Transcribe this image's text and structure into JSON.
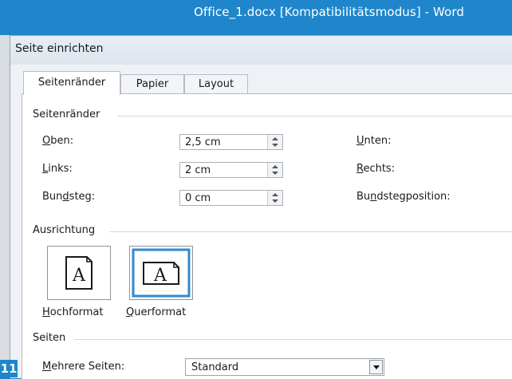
{
  "window": {
    "title": "Office_1.docx [Kompatibilitätsmodus] - Word"
  },
  "dialog": {
    "title": "Seite einrichten"
  },
  "tabs": [
    {
      "label": "Seitenränder",
      "active": true
    },
    {
      "label": "Papier",
      "active": false
    },
    {
      "label": "Layout",
      "active": false
    }
  ],
  "margins": {
    "group_label": "Seitenränder",
    "oben": {
      "label_pre": "",
      "label_u": "O",
      "label_post": "ben:",
      "value": "2,5 cm"
    },
    "links": {
      "label_pre": "",
      "label_u": "L",
      "label_post": "inks:",
      "value": "2 cm"
    },
    "bundsteg": {
      "label_pre": "Bun",
      "label_u": "d",
      "label_post": "steg:",
      "value": "0 cm"
    },
    "unten": {
      "label_pre": "",
      "label_u": "U",
      "label_post": "nten:"
    },
    "rechts": {
      "label_pre": "",
      "label_u": "R",
      "label_post": "echts:"
    },
    "bundstegposition": {
      "label_pre": "Bu",
      "label_u": "n",
      "label_post": "dstegposition:"
    }
  },
  "orientation": {
    "group_label": "Ausrichtung",
    "portrait": {
      "label_u": "H",
      "label_post": "ochformat",
      "glyph": "A",
      "selected": false
    },
    "landscape": {
      "label_u": "Q",
      "label_post": "uerformat",
      "glyph": "A",
      "selected": true
    }
  },
  "pages": {
    "group_label": "Seiten",
    "mehrere": {
      "label_pre": "",
      "label_u": "M",
      "label_post": "ehrere Seiten:",
      "value": "Standard"
    }
  },
  "step_badge": "11",
  "colors": {
    "titlebar": "#1f86cc",
    "selection": "#2f8ad1"
  }
}
